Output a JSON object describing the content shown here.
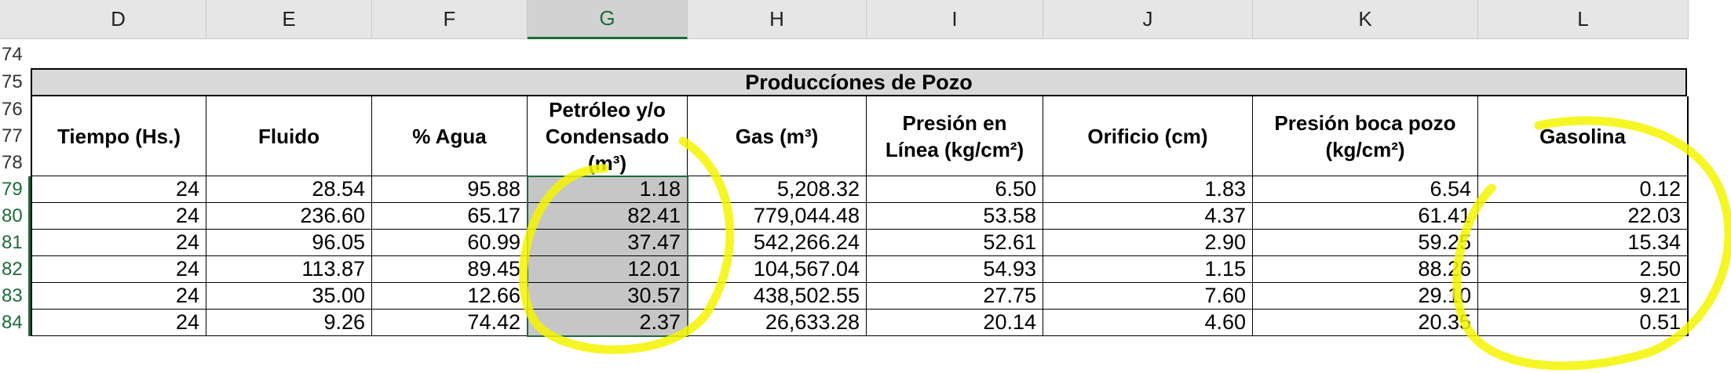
{
  "columns": [
    "D",
    "E",
    "F",
    "G",
    "H",
    "I",
    "J",
    "K",
    "L"
  ],
  "row_numbers": [
    "74",
    "75",
    "76",
    "77",
    "78",
    "79",
    "80",
    "81",
    "82",
    "83",
    "84"
  ],
  "title": "Produccíones de Pozo",
  "headers": [
    "Tiempo (Hs.)",
    "Fluido",
    "% Agua",
    "Petróleo y/o Condensado (m³)",
    "Gas (m³)",
    "Presión en Línea (kg/cm²)",
    "Orificio (cm)",
    "Presión boca pozo (kg/cm²)",
    "Gasolina"
  ],
  "rows": [
    [
      "24",
      "28.54",
      "95.88",
      "1.18",
      "5,208.32",
      "6.50",
      "1.83",
      "6.54",
      "0.12"
    ],
    [
      "24",
      "236.60",
      "65.17",
      "82.41",
      "779,044.48",
      "53.58",
      "4.37",
      "61.41",
      "22.03"
    ],
    [
      "24",
      "96.05",
      "60.99",
      "37.47",
      "542,266.24",
      "52.61",
      "2.90",
      "59.25",
      "15.34"
    ],
    [
      "24",
      "113.87",
      "89.45",
      "12.01",
      "104,567.04",
      "54.93",
      "1.15",
      "88.26",
      "2.50"
    ],
    [
      "24",
      "35.00",
      "12.66",
      "30.57",
      "438,502.55",
      "27.75",
      "7.60",
      "29.10",
      "9.21"
    ],
    [
      "24",
      "9.26",
      "74.42",
      "2.37",
      "26,633.28",
      "20.14",
      "4.60",
      "20.35",
      "0.51"
    ]
  ],
  "selected_column": "G",
  "highlight_color": "#f5f500",
  "selection_color": "#1e6b3a"
}
